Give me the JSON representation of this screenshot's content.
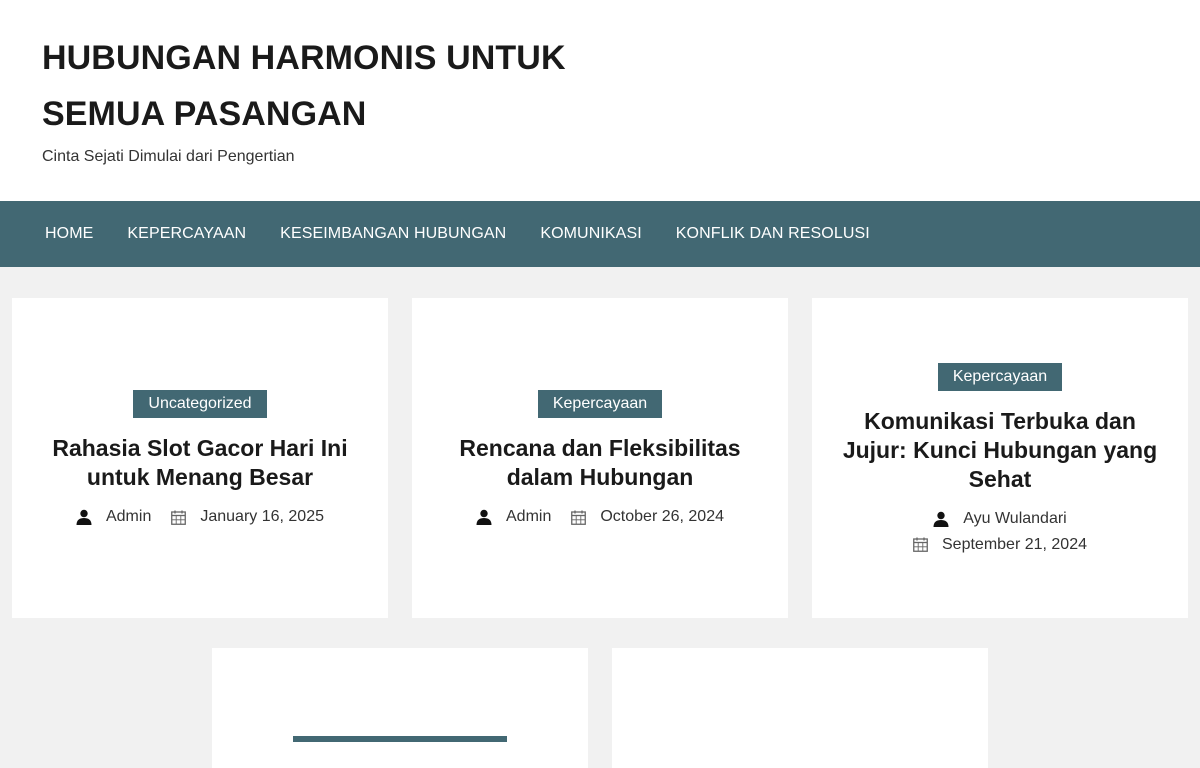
{
  "site": {
    "title": "HUBUNGAN HARMONIS UNTUK SEMUA PASANGAN",
    "tagline": "Cinta Sejati Dimulai dari Pengertian"
  },
  "nav": {
    "items": [
      {
        "label": "HOME"
      },
      {
        "label": "KEPERCAYAAN"
      },
      {
        "label": "KESEIMBANGAN HUBUNGAN"
      },
      {
        "label": "KOMUNIKASI"
      },
      {
        "label": "KONFLIK DAN RESOLUSI"
      }
    ]
  },
  "posts": [
    {
      "category": "Uncategorized",
      "title": "Rahasia Slot Gacor Hari Ini untuk Menang Besar",
      "author": "Admin",
      "date": "January 16, 2025"
    },
    {
      "category": "Kepercayaan",
      "title": "Rencana dan Fleksibilitas dalam Hubungan",
      "author": "Admin",
      "date": "October 26, 2024"
    },
    {
      "category": "Kepercayaan",
      "title": "Komunikasi Terbuka dan Jujur: Kunci Hubungan yang Sehat",
      "author": "Ayu Wulandari",
      "date": "September 21, 2024"
    }
  ],
  "colors": {
    "accent": "#426873",
    "background": "#f1f1f1",
    "card": "#ffffff"
  },
  "icons": {
    "author": "user-icon",
    "date": "calendar-icon"
  }
}
